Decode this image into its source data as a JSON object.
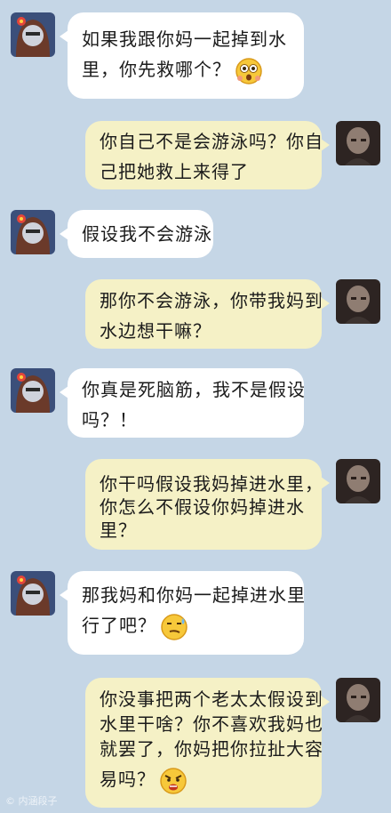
{
  "messages": [
    {
      "side": "left",
      "lines": [
        "如果我跟你妈一起掉到水",
        "里，你先救哪个？"
      ],
      "emoji": "shocked-face-emoji"
    },
    {
      "side": "right",
      "lines": [
        "你自己不是会游泳吗？你自",
        "己把她救上来得了"
      ]
    },
    {
      "side": "left",
      "lines": [
        "假设我不会游泳"
      ]
    },
    {
      "side": "right",
      "lines": [
        "那你不会游泳，你带我妈到",
        "水边想干嘛？"
      ]
    },
    {
      "side": "left",
      "lines": [
        "你真是死脑筋，我不是假设",
        "吗？！"
      ]
    },
    {
      "side": "right",
      "lines": [
        "你干吗假设我妈掉进水里，",
        "你怎么不假设你妈掉进水",
        "里？"
      ]
    },
    {
      "side": "left",
      "lines": [
        "那我妈和你妈一起掉进水里",
        "行了吧？"
      ],
      "emoji": "sweat-smirk-emoji"
    },
    {
      "side": "right",
      "lines": [
        "你没事把两个老太太假设到",
        "水里干啥？你不喜欢我妈也",
        "就罢了，你妈把你拉扯大容",
        "易吗？"
      ],
      "emoji": "angry-face-emoji"
    }
  ],
  "watermark": "© 内涵段子"
}
